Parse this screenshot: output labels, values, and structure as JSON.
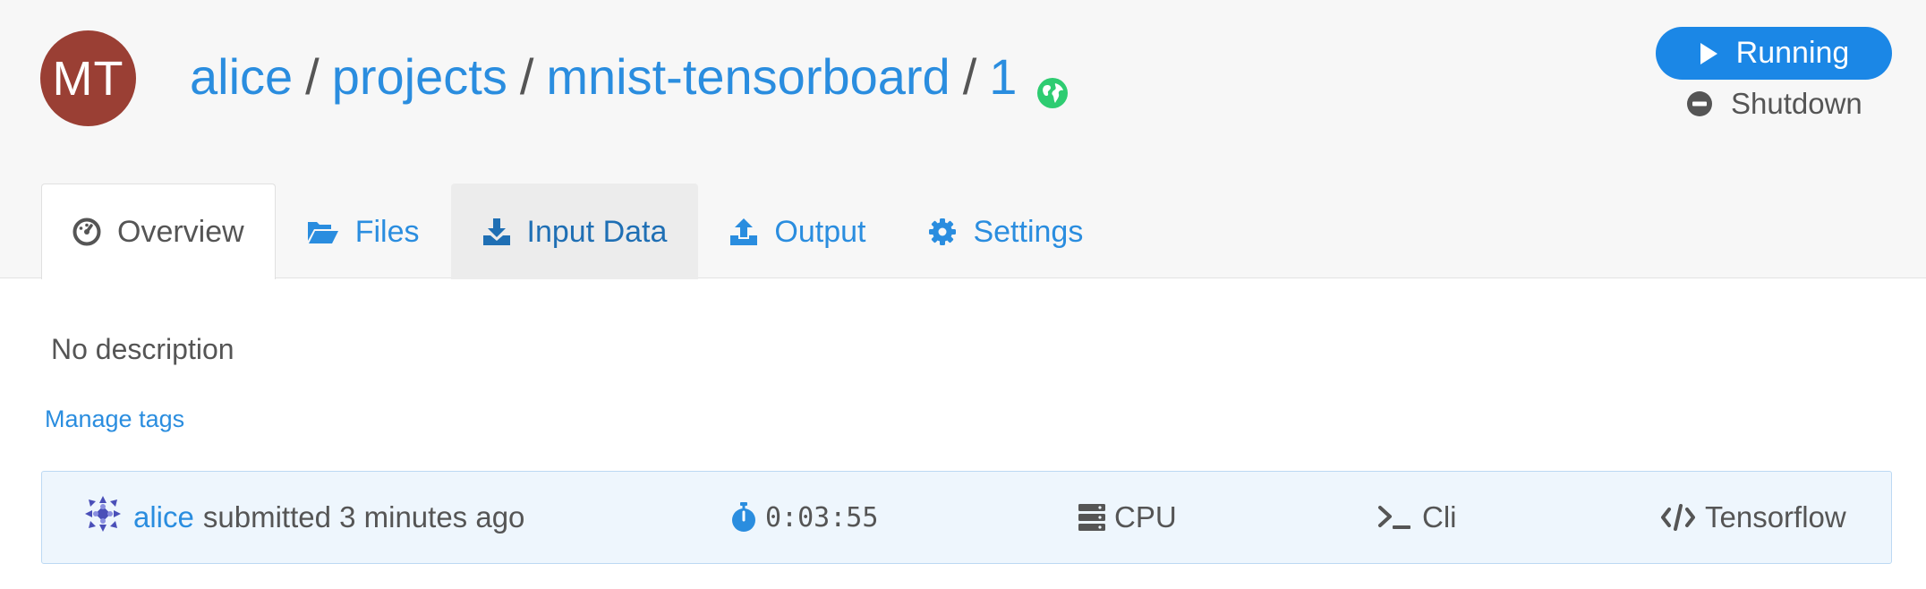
{
  "header": {
    "avatar_initials": "MT",
    "avatar_color": "#9a3f34",
    "breadcrumb": {
      "owner": "alice",
      "section": "projects",
      "project": "mnist-tensorboard",
      "run_number": "1",
      "separator": "/",
      "visibility_icon": "globe-icon"
    },
    "status_button": {
      "label": "Running",
      "icon": "play-icon",
      "color": "#1b87e6"
    },
    "shutdown": {
      "label": "Shutdown",
      "icon": "minus-circle-icon"
    }
  },
  "tabs": [
    {
      "label": "Overview",
      "icon": "dashboard-icon",
      "state": "active"
    },
    {
      "label": "Files",
      "icon": "folder-open-icon",
      "state": "normal"
    },
    {
      "label": "Input Data",
      "icon": "download-icon",
      "state": "hover"
    },
    {
      "label": "Output",
      "icon": "upload-icon",
      "state": "normal"
    },
    {
      "label": "Settings",
      "icon": "gear-icon",
      "state": "normal"
    }
  ],
  "overview": {
    "description": "No description",
    "manage_tags": "Manage tags"
  },
  "info_bar": {
    "user": "alice",
    "submitted_text": "submitted 3 minutes ago",
    "duration": "0:03:55",
    "machine": "CPU",
    "mode": "Cli",
    "framework": "Tensorflow"
  },
  "colors": {
    "link": "#2a8ddf",
    "header_bg": "#f7f7f7",
    "info_bg": "#eef6fd"
  }
}
